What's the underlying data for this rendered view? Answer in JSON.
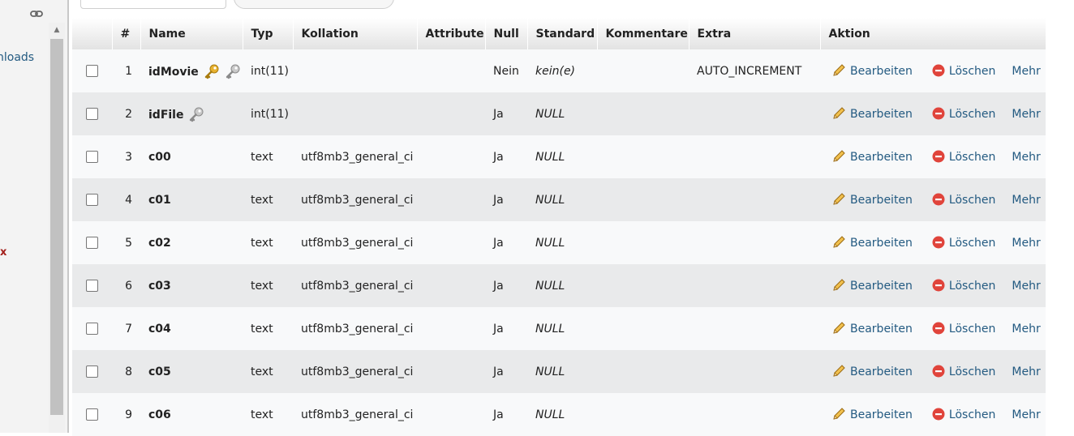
{
  "sidebar": {
    "downloads_partial": "nloads",
    "red_mark": "x",
    "link_icon": "chain-link-icon"
  },
  "table": {
    "headers": [
      "#",
      "Name",
      "Typ",
      "Kollation",
      "Attribute",
      "Null",
      "Standard",
      "Kommentare",
      "Extra",
      "Aktion"
    ],
    "rows": [
      {
        "num": "1",
        "name": "idMovie",
        "type": "int(11)",
        "collation": "",
        "attributes": "",
        "null": "Nein",
        "default": "kein(e)",
        "comment": "",
        "extra": "AUTO_INCREMENT",
        "keys": [
          "primary-key-icon",
          "index-key-icon"
        ]
      },
      {
        "num": "2",
        "name": "idFile",
        "type": "int(11)",
        "collation": "",
        "attributes": "",
        "null": "Ja",
        "default": "NULL",
        "comment": "",
        "extra": "",
        "keys": [
          "index-key-icon"
        ]
      },
      {
        "num": "3",
        "name": "c00",
        "type": "text",
        "collation": "utf8mb3_general_ci",
        "attributes": "",
        "null": "Ja",
        "default": "NULL",
        "comment": "",
        "extra": "",
        "keys": []
      },
      {
        "num": "4",
        "name": "c01",
        "type": "text",
        "collation": "utf8mb3_general_ci",
        "attributes": "",
        "null": "Ja",
        "default": "NULL",
        "comment": "",
        "extra": "",
        "keys": []
      },
      {
        "num": "5",
        "name": "c02",
        "type": "text",
        "collation": "utf8mb3_general_ci",
        "attributes": "",
        "null": "Ja",
        "default": "NULL",
        "comment": "",
        "extra": "",
        "keys": []
      },
      {
        "num": "6",
        "name": "c03",
        "type": "text",
        "collation": "utf8mb3_general_ci",
        "attributes": "",
        "null": "Ja",
        "default": "NULL",
        "comment": "",
        "extra": "",
        "keys": []
      },
      {
        "num": "7",
        "name": "c04",
        "type": "text",
        "collation": "utf8mb3_general_ci",
        "attributes": "",
        "null": "Ja",
        "default": "NULL",
        "comment": "",
        "extra": "",
        "keys": []
      },
      {
        "num": "8",
        "name": "c05",
        "type": "text",
        "collation": "utf8mb3_general_ci",
        "attributes": "",
        "null": "Ja",
        "default": "NULL",
        "comment": "",
        "extra": "",
        "keys": []
      },
      {
        "num": "9",
        "name": "c06",
        "type": "text",
        "collation": "utf8mb3_general_ci",
        "attributes": "",
        "null": "Ja",
        "default": "NULL",
        "comment": "",
        "extra": "",
        "keys": []
      }
    ],
    "actions": {
      "edit_label": "Bearbeiten",
      "edit_icon": "pencil-icon",
      "delete_label": "Löschen",
      "delete_icon": "delete-circle-icon",
      "more_label": "Mehr"
    }
  },
  "colors": {
    "link": "#235a81",
    "row_odd": "#f8f9fa",
    "row_even": "#e9eaeb",
    "delete_red": "#e0443b",
    "key_gold": "#e8b230"
  }
}
